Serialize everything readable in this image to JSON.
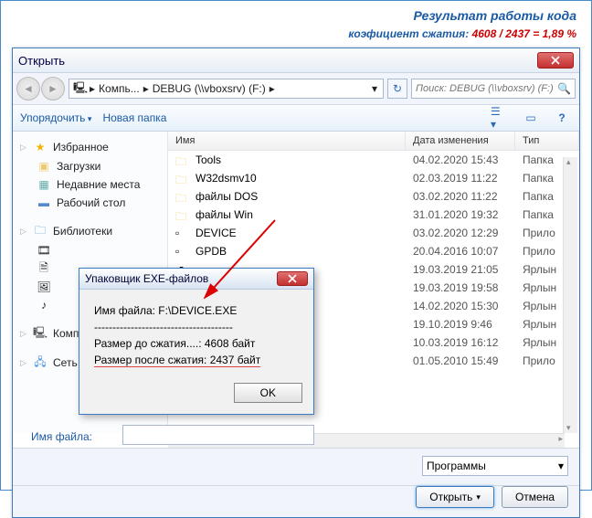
{
  "caption": {
    "line1": "Результат работы кода",
    "line2_label": "коэфициент сжатия: ",
    "line2_ratio": "4608 / 2437 = 1,89 %"
  },
  "dialog": {
    "title": "Открыть",
    "breadcrumb": [
      "Компь...",
      "DEBUG (\\\\vboxsrv) (F:)"
    ],
    "search_placeholder": "Поиск: DEBUG (\\\\vboxsrv) (F:)",
    "toolbar": {
      "organize": "Упорядочить",
      "new_folder": "Новая папка"
    },
    "sidebar": {
      "favorites": "Избранное",
      "fav_items": [
        "Загрузки",
        "Недавние места",
        "Рабочий стол"
      ],
      "libraries": "Библиотеки",
      "computer": "Компьютер",
      "network": "Сеть"
    },
    "columns": {
      "name": "Имя",
      "date": "Дата изменения",
      "type": "Тип"
    },
    "files": [
      {
        "name": "Tools",
        "date": "04.02.2020 15:43",
        "type": "Папка",
        "kind": "folder"
      },
      {
        "name": "W32dsmv10",
        "date": "02.03.2019 11:22",
        "type": "Папка",
        "kind": "folder"
      },
      {
        "name": "файлы DOS",
        "date": "03.02.2020 11:22",
        "type": "Папка",
        "kind": "folder"
      },
      {
        "name": "файлы Win",
        "date": "31.01.2020 19:32",
        "type": "Папка",
        "kind": "folder"
      },
      {
        "name": "DEVICE",
        "date": "03.02.2020 12:29",
        "type": "Прило",
        "kind": "exe"
      },
      {
        "name": "GPDB",
        "date": "20.04.2016 10:07",
        "type": "Прило",
        "kind": "exe"
      },
      {
        "name": "",
        "date": "19.03.2019 21:05",
        "type": "Ярлын",
        "kind": "link"
      },
      {
        "name": "",
        "date": "19.03.2019 19:58",
        "type": "Ярлын",
        "kind": "link"
      },
      {
        "name": "",
        "date": "14.02.2020 15:30",
        "type": "Ярлын",
        "kind": "link"
      },
      {
        "name": "",
        "date": "19.10.2019 9:46",
        "type": "Ярлын",
        "kind": "link"
      },
      {
        "name": "",
        "date": "10.03.2019 16:12",
        "type": "Ярлын",
        "kind": "link"
      },
      {
        "name": "",
        "date": "01.05.2010 15:49",
        "type": "Прило",
        "kind": "exe"
      }
    ],
    "filename_label": "Имя файла:",
    "filter": "Программы",
    "open_btn": "Открыть",
    "cancel_btn": "Отмена"
  },
  "msgbox": {
    "title": "Упаковщик EXE-файлов",
    "line1": "Имя файла: F:\\DEVICE.EXE",
    "sep": "--------------------------------------",
    "line2": "Размер до сжатия....: 4608 байт",
    "line3": "Размер после сжатия: 2437 байт",
    "ok": "OK"
  }
}
